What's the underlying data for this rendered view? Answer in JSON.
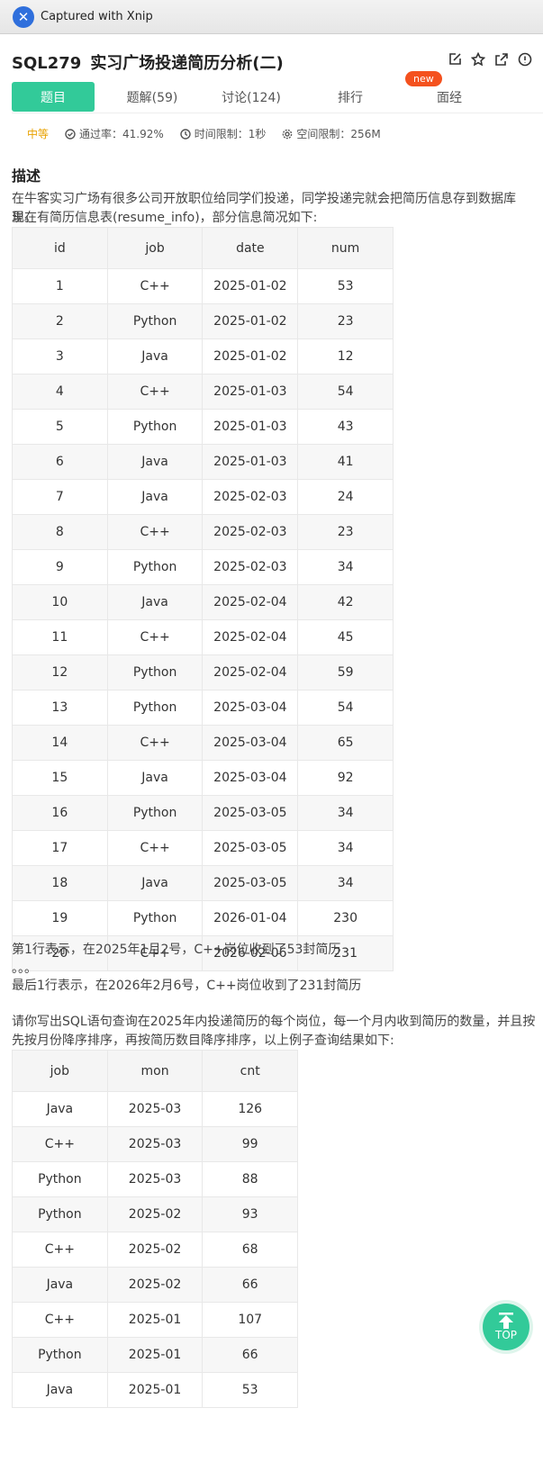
{
  "titlebar": {
    "text": "Captured with Xnip"
  },
  "question": {
    "code": "SQL279",
    "title": "实习广场投递简历分析(二)"
  },
  "tabs": [
    {
      "label": "题目"
    },
    {
      "label": "题解(59)"
    },
    {
      "label": "讨论(124)"
    },
    {
      "label": "排行"
    },
    {
      "label": "面经"
    }
  ],
  "new_badge": "new",
  "meta": {
    "difficulty": "中等",
    "pass_rate": "通过率：41.92%",
    "time_limit": "时间限制：1秒",
    "space_limit": "空间限制：256M"
  },
  "description": {
    "heading": "描述",
    "line1": "在牛客实习广场有很多公司开放职位给同学们投递，同学投递完就会把简历信息存到数据库里。",
    "line2": "现在有简历信息表(resume_info)，部分信息简况如下:",
    "after1": "第1行表示，在2025年1月2号，C++岗位收到了53封简历",
    "after2": "。。。",
    "after3": "最后1行表示，在2026年2月6号，C++岗位收到了231封简历",
    "query1": "请你写出SQL语句查询在2025年内投递简历的每个岗位，每一个月内收到简历的数量，并且按",
    "query2": "先按月份降序排序，再按简历数目降序排序，以上例子查询结果如下:"
  },
  "resume_table": {
    "headers": [
      "id",
      "job",
      "date",
      "num"
    ],
    "rows": [
      [
        "1",
        "C++",
        "2025-01-02",
        "53"
      ],
      [
        "2",
        "Python",
        "2025-01-02",
        "23"
      ],
      [
        "3",
        "Java",
        "2025-01-02",
        "12"
      ],
      [
        "4",
        "C++",
        "2025-01-03",
        "54"
      ],
      [
        "5",
        "Python",
        "2025-01-03",
        "43"
      ],
      [
        "6",
        "Java",
        "2025-01-03",
        "41"
      ],
      [
        "7",
        "Java",
        "2025-02-03",
        "24"
      ],
      [
        "8",
        "C++",
        "2025-02-03",
        "23"
      ],
      [
        "9",
        "Python",
        "2025-02-03",
        "34"
      ],
      [
        "10",
        "Java",
        "2025-02-04",
        "42"
      ],
      [
        "11",
        "C++",
        "2025-02-04",
        "45"
      ],
      [
        "12",
        "Python",
        "2025-02-04",
        "59"
      ],
      [
        "13",
        "Python",
        "2025-03-04",
        "54"
      ],
      [
        "14",
        "C++",
        "2025-03-04",
        "65"
      ],
      [
        "15",
        "Java",
        "2025-03-04",
        "92"
      ],
      [
        "16",
        "Python",
        "2025-03-05",
        "34"
      ],
      [
        "17",
        "C++",
        "2025-03-05",
        "34"
      ],
      [
        "18",
        "Java",
        "2025-03-05",
        "34"
      ],
      [
        "19",
        "Python",
        "2026-01-04",
        "230"
      ],
      [
        "20",
        "C++",
        "2026-02-06",
        "231"
      ]
    ]
  },
  "result_table": {
    "headers": [
      "job",
      "mon",
      "cnt"
    ],
    "rows": [
      [
        "Java",
        "2025-03",
        "126"
      ],
      [
        "C++",
        "2025-03",
        "99"
      ],
      [
        "Python",
        "2025-03",
        "88"
      ],
      [
        "Python",
        "2025-02",
        "93"
      ],
      [
        "C++",
        "2025-02",
        "68"
      ],
      [
        "Java",
        "2025-02",
        "66"
      ],
      [
        "C++",
        "2025-01",
        "107"
      ],
      [
        "Python",
        "2025-01",
        "66"
      ],
      [
        "Java",
        "2025-01",
        "53"
      ]
    ]
  },
  "top_button": {
    "label": "TOP"
  },
  "colors": {
    "accent": "#32ca99",
    "difficulty": "#e8a100",
    "badge": "#f4511e"
  }
}
